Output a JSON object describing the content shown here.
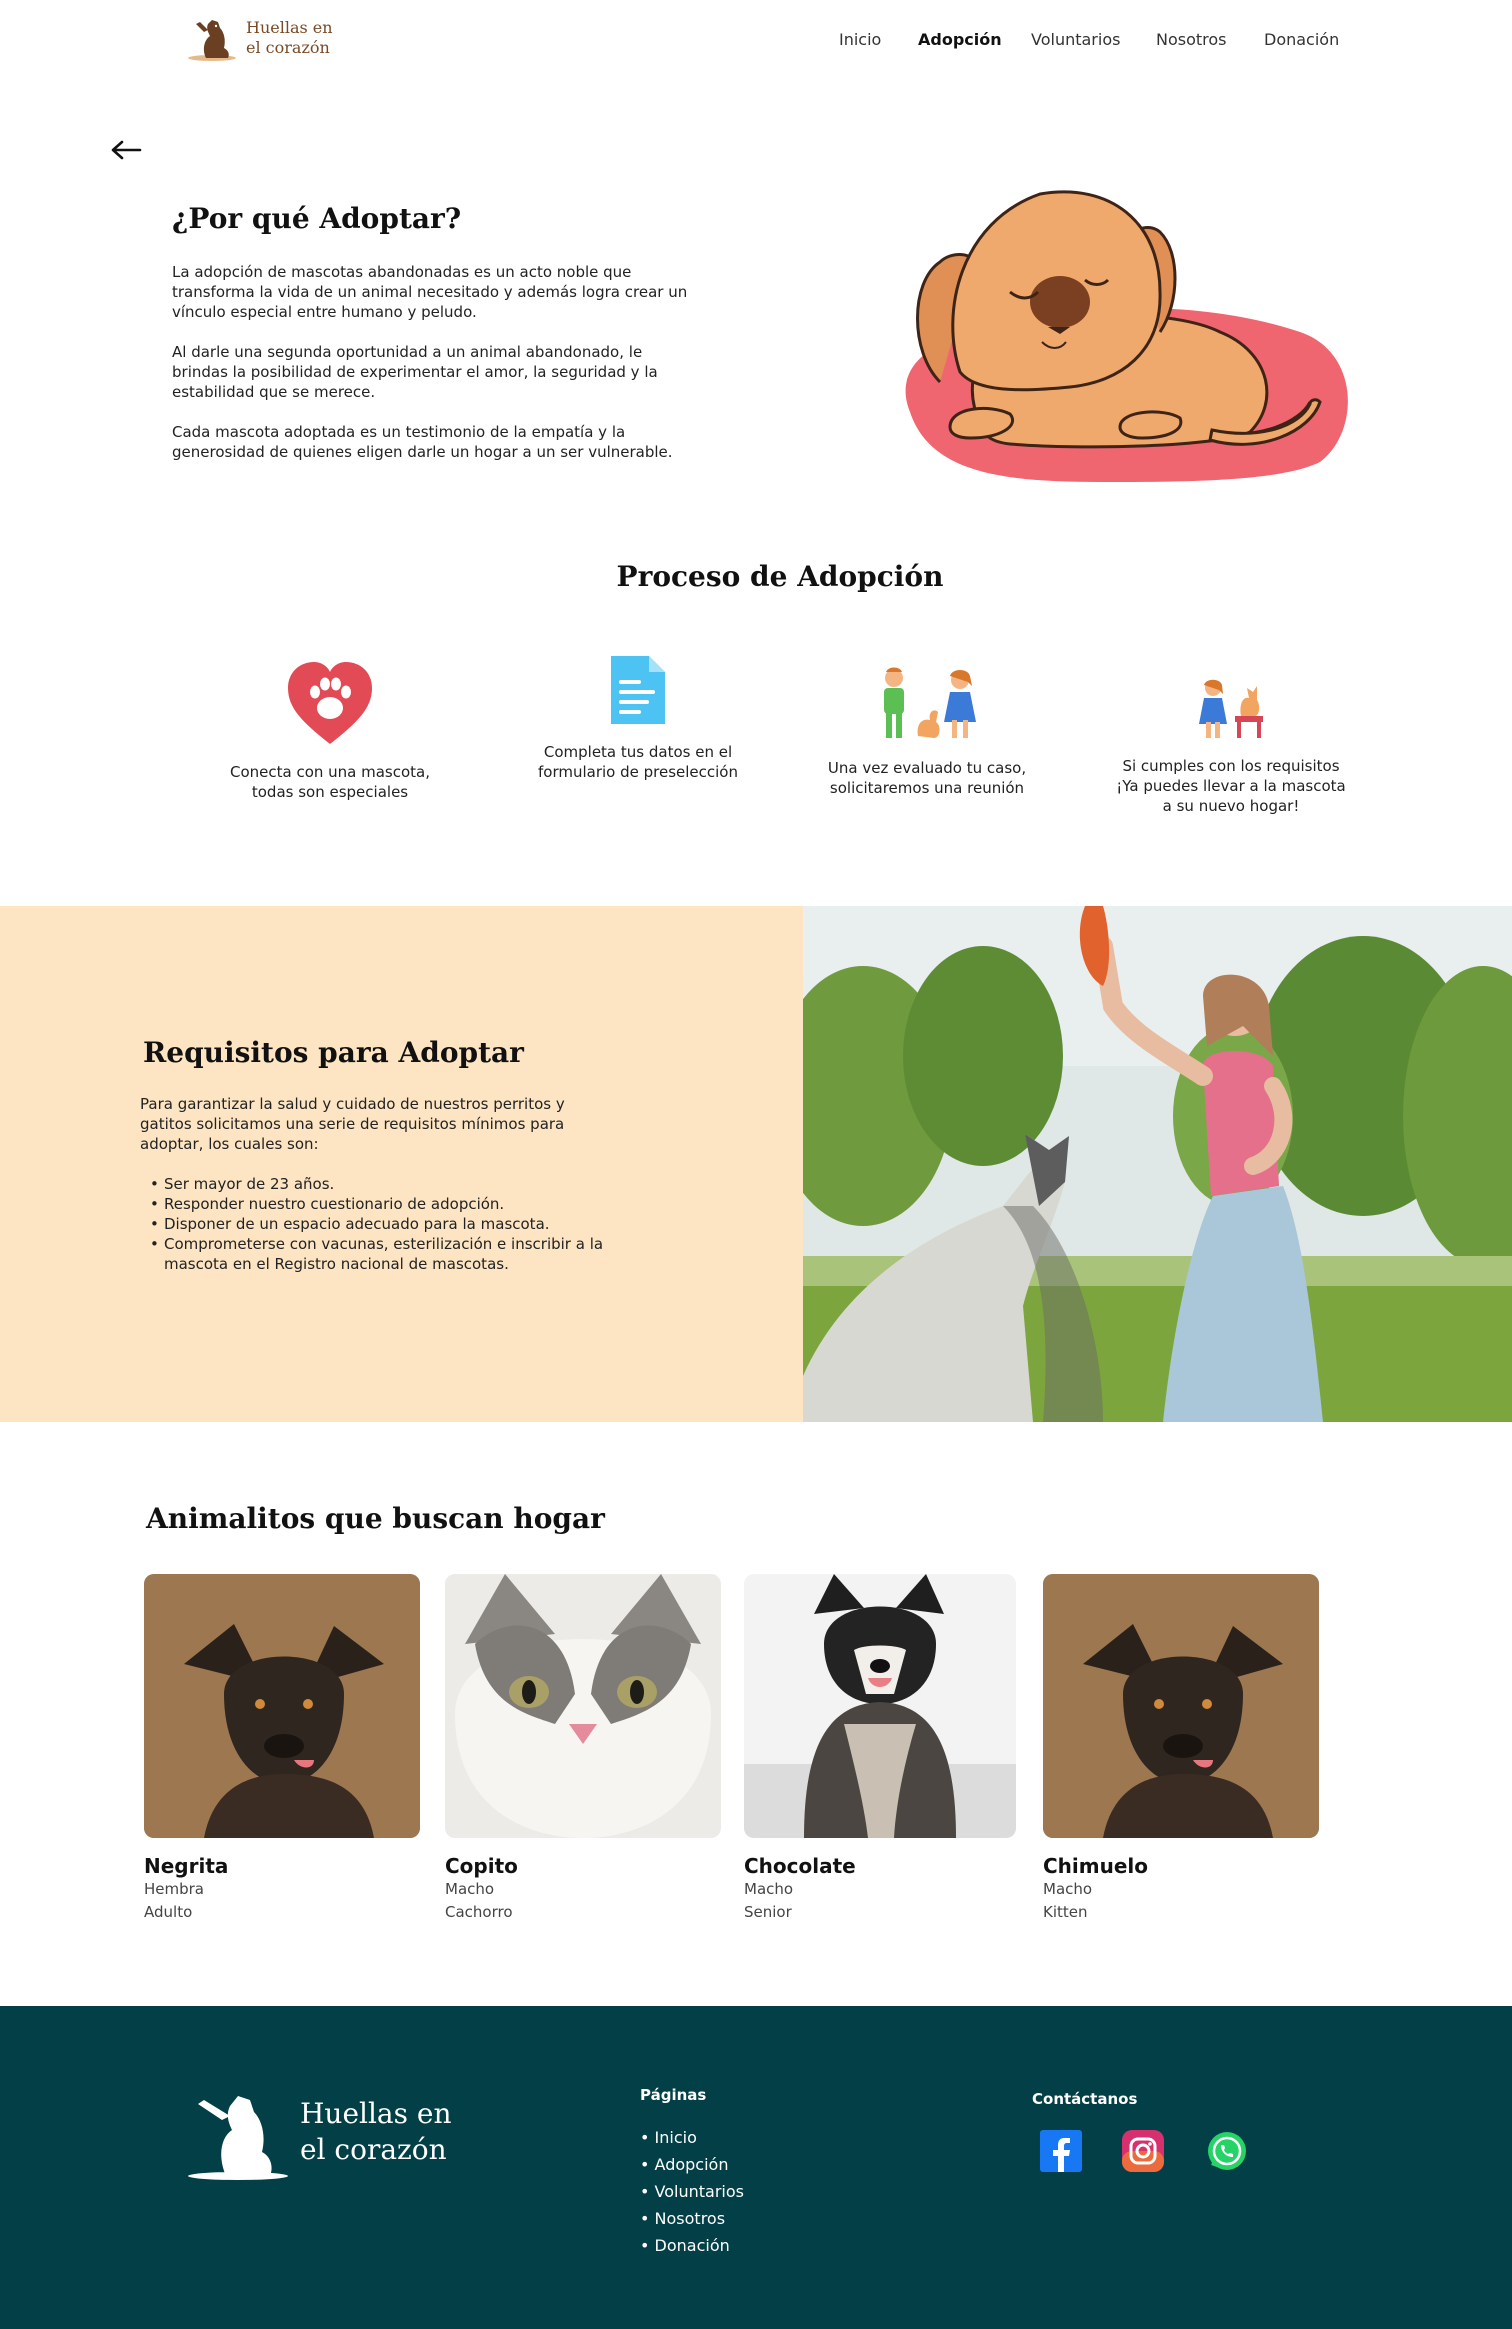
{
  "brand": {
    "name_line1": "Huellas en",
    "name_line2": "el corazón"
  },
  "nav": {
    "items": [
      {
        "label": "Inicio",
        "active": false
      },
      {
        "label": "Adopción",
        "active": true
      },
      {
        "label": "Voluntarios",
        "active": false
      },
      {
        "label": "Nosotros",
        "active": false
      },
      {
        "label": "Donación",
        "active": false
      }
    ]
  },
  "back_icon": "arrow-left-icon",
  "why": {
    "title": "¿Por qué Adoptar?",
    "paragraphs": [
      "La adopción de mascotas abandonadas es un acto noble que transforma la vida de un animal necesitado y además logra crear un vínculo especial entre humano y peludo.",
      "Al darle una segunda oportunidad a un animal abandonado, le brindas la posibilidad de experimentar el amor, la seguridad y la estabilidad que se merece.",
      "Cada mascota adoptada es un testimonio de la empatía y la generosidad de quienes eligen darle un hogar a un ser vulnerable."
    ]
  },
  "process": {
    "title": "Proceso de Adopción",
    "steps": [
      {
        "icon": "paw-heart-icon",
        "label_line1": "Conecta con una mascota,",
        "label_line2": "todas son especiales",
        "label_line3": ""
      },
      {
        "icon": "document-icon",
        "label_line1": "Completa tus datos en el",
        "label_line2": "formulario de preselección",
        "label_line3": ""
      },
      {
        "icon": "meeting-icon",
        "label_line1": "Una vez evaluado tu caso,",
        "label_line2": "solicitaremos una reunión",
        "label_line3": ""
      },
      {
        "icon": "new-home-icon",
        "label_line1": "Si cumples con los requisitos",
        "label_line2": "¡Ya puedes llevar a la mascota",
        "label_line3": "a su nuevo hogar!"
      }
    ]
  },
  "requirements": {
    "title": "Requisitos para Adoptar",
    "intro": "Para garantizar la salud y cuidado de nuestros perritos y gatitos solicitamos una serie de requisitos mínimos para adoptar,  los cuales son:",
    "items": [
      "Ser mayor de 23 años.",
      "Responder nuestro cuestionario de adopción.",
      "Disponer de un espacio adecuado para la mascota.",
      "Comprometerse con vacunas, esterilización e inscribir a la mascota en el Registro nacional de mascotas."
    ]
  },
  "pets": {
    "title": "Animalitos que buscan hogar",
    "items": [
      {
        "name": "Negrita",
        "sex": "Hembra",
        "age": "Adulto"
      },
      {
        "name": "Copito",
        "sex": "Macho",
        "age": "Cachorro"
      },
      {
        "name": "Chocolate",
        "sex": "Macho",
        "age": "Senior"
      },
      {
        "name": "Chimuelo",
        "sex": "Macho",
        "age": "Kitten"
      }
    ]
  },
  "footer": {
    "brand_line1": "Huellas en",
    "brand_line2": "el corazón",
    "pages_title": "Páginas",
    "pages": [
      "Inicio",
      "Adopción",
      "Voluntarios",
      "Nosotros",
      "Donación"
    ],
    "contact_title": "Contáctanos",
    "social": [
      "facebook-icon",
      "instagram-icon",
      "whatsapp-icon"
    ]
  },
  "colors": {
    "footer_bg": "#023f47",
    "requirements_bg": "#fde5c3",
    "brand_brown": "#7a4a25"
  }
}
